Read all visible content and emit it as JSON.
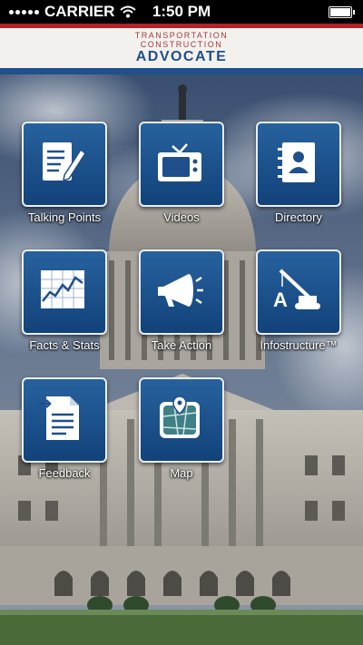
{
  "status_bar": {
    "carrier": "CARRIER",
    "time": "1:50 PM"
  },
  "header": {
    "line1": "TRANSPORTATION",
    "line2": "CONSTRUCTION",
    "line3": "ADVOCATE",
    "accent_red": "#b32227",
    "accent_blue": "#1f4f8c"
  },
  "tiles": [
    {
      "label": "Talking Points",
      "icon": "document-pencil-icon"
    },
    {
      "label": "Videos",
      "icon": "tv-icon"
    },
    {
      "label": "Directory",
      "icon": "address-book-icon"
    },
    {
      "label": "Facts & Stats",
      "icon": "line-chart-icon"
    },
    {
      "label": "Take Action",
      "icon": "megaphone-icon"
    },
    {
      "label": "Infostructure™",
      "icon": "crane-icon"
    },
    {
      "label": "Feedback",
      "icon": "feedback-document-icon"
    },
    {
      "label": "Map",
      "icon": "map-icon"
    }
  ]
}
